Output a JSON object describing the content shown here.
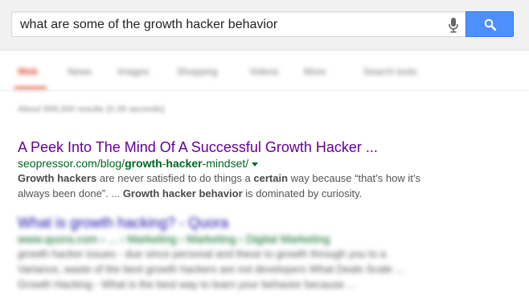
{
  "search": {
    "query": "what are some of the growth hacker behavior",
    "mic_icon": "microphone-icon",
    "search_icon": "magnifier-icon"
  },
  "tabs": [
    "Web",
    "News",
    "Images",
    "Shopping",
    "Videos",
    "More",
    "Search tools"
  ],
  "stats_text": "About 999,000 results (0.39 seconds)",
  "results": [
    {
      "title": "A Peek Into The Mind Of A Successful Growth Hacker ...",
      "url_prefix": "seopressor.com/blog/",
      "url_bold1": "growth",
      "url_mid": "-",
      "url_bold2": "hacker",
      "url_suffix": "-mindset/",
      "snippet_line1_b1": "Growth hackers",
      "snippet_line1_t1": " are never satisfied to do things a ",
      "snippet_line1_b2": "certain",
      "snippet_line1_t2": " way because “that’s how it’s",
      "snippet_line2_t1": "always been done”. ... ",
      "snippet_line2_b1": "Growth hacker behavior",
      "snippet_line2_t2": " is dominated by curiosity."
    },
    {
      "title": "What is growth hacking? - Quora",
      "url": "www.quora.com › ... › Marketing › Marketing › Digital Marketing",
      "snippet1": "growth hacker issues - due since personal and these to growth through you to a",
      "snippet2": "Variance, waste of the best growth hackers are not developers What Deals Scale ...",
      "snippet3": "Growth Hacking - What is the best way to learn your behavior because ..."
    }
  ],
  "colors": {
    "visited_link": "#660099",
    "link": "#1a0dab",
    "url_green": "#006621",
    "search_button": "#4d90fe",
    "active_tab": "#dd4b39"
  }
}
